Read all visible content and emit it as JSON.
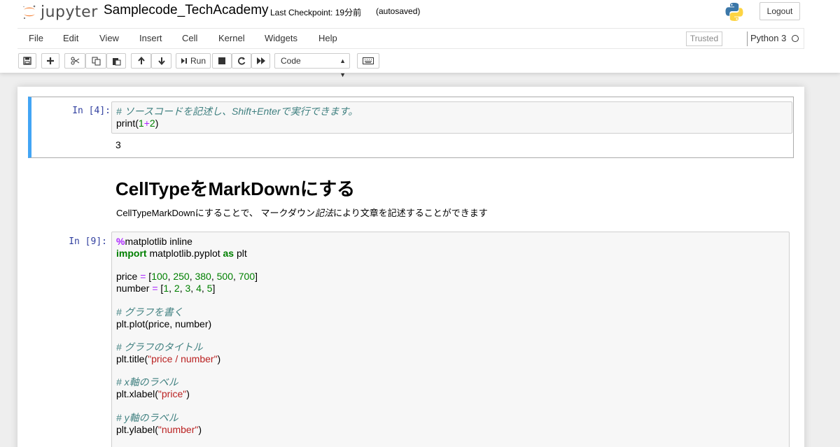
{
  "header": {
    "logo_text": "jupyter",
    "notebook_name": "Samplecode_TechAcademy",
    "checkpoint": "Last Checkpoint: 19分前",
    "autosaved": "(autosaved)",
    "logout_label": "Logout"
  },
  "menu": {
    "items": [
      "File",
      "Edit",
      "View",
      "Insert",
      "Cell",
      "Kernel",
      "Widgets",
      "Help"
    ],
    "trusted": "Trusted",
    "kernel": "Python 3"
  },
  "toolbar": {
    "run_label": "Run",
    "cell_type": "Code",
    "icons": [
      "save-icon",
      "plus-icon",
      "cut-icon",
      "copy-icon",
      "paste-icon",
      "arrow-up-icon",
      "arrow-down-icon",
      "run-icon",
      "stop-icon",
      "restart-icon",
      "fast-forward-icon",
      "keyboard-icon"
    ]
  },
  "cells": {
    "cell1": {
      "prompt": "In [4]:",
      "line1": "# ソースコードを記述し、Shift+Enterで実行できます。",
      "line2_func": "print(",
      "line2_a": "1",
      "line2_op": "+",
      "line2_b": "2",
      "line2_close": ")",
      "output": "3"
    },
    "markdown": {
      "heading": "CellTypeをMarkDownにする",
      "paragraph_a": "CellTypeMarkDownにすることで、 マークダウン",
      "paragraph_em": "記法",
      "paragraph_b": "により文章を記述することができます"
    },
    "cell2": {
      "prompt": "In [9]:",
      "magic": "%",
      "magic_rest": "matplotlib inline",
      "import_kw": "import",
      "import_mod": " matplotlib.pyplot ",
      "as_kw": "as",
      "import_alias": " plt",
      "price_name": "price ",
      "price_eq": "=",
      "price_open": " [",
      "price_values": [
        "100",
        "250",
        "380",
        "500",
        "700"
      ],
      "price_close": "]",
      "number_name": "number ",
      "number_eq": "=",
      "number_open": " [",
      "number_values": [
        "1",
        "2",
        "3",
        "4",
        "5"
      ],
      "number_close": "]",
      "comment_plot": "# グラフを書く",
      "plot_call": "plt.plot(price, number)",
      "comment_title": "# グラフのタイトル",
      "title_fn": "plt.title(",
      "title_str": "\"price / number\"",
      "title_close": ")",
      "comment_xlabel": "# x軸のラベル",
      "xlabel_fn": "plt.xlabel(",
      "xlabel_str": "\"price\"",
      "xlabel_close": ")",
      "comment_ylabel": "# y軸のラベル",
      "ylabel_fn": "plt.ylabel(",
      "ylabel_str": "\"number\"",
      "ylabel_close": ")"
    }
  },
  "colors": {
    "selected_border": "#42a5f5",
    "prompt": "#303f9f",
    "comment": "#408080",
    "number": "#008000",
    "string": "#ba2121",
    "operator": "#aa22ff"
  }
}
